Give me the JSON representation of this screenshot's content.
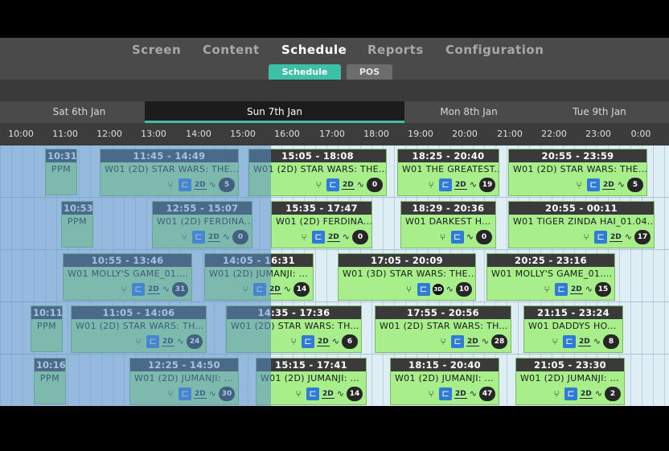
{
  "nav": {
    "items": [
      "Screen",
      "Content",
      "Schedule",
      "Reports",
      "Configuration"
    ],
    "active": "Schedule"
  },
  "subtabs": [
    "Schedule",
    "POS"
  ],
  "days": [
    "Sat 6th Jan",
    "Sun 7th Jan",
    "Mon 8th Jan",
    "Tue 9th Jan"
  ],
  "active_day": "Sun 7th Jan",
  "hours": [
    "10:00",
    "11:00",
    "12:00",
    "13:00",
    "14:00",
    "15:00",
    "16:00",
    "17:00",
    "18:00",
    "19:00",
    "20:00",
    "21:00",
    "22:00",
    "23:00",
    "0:00"
  ],
  "colors": {
    "accent": "#3dbfa8",
    "session_bg": "#a8ee8a",
    "header_bg": "#3a3a3a",
    "past_overlay": "#5a8fca",
    "icon_blue": "#2f7bd6"
  },
  "rows": [
    {
      "ppm": {
        "time": "10:31 -",
        "title": "PPM"
      },
      "sessions": [
        {
          "time": "11:45 - 14:49",
          "title": "W01 (2D) STAR WARS: THE...",
          "format": "2D",
          "count": "5"
        },
        {
          "time": "15:05 - 18:08",
          "title": "W01 (2D) STAR WARS: THE...",
          "format": "2D",
          "count": "0"
        },
        {
          "time": "18:25 - 20:40",
          "title": "W01 THE GREATEST...",
          "format": "2D",
          "count": "19"
        },
        {
          "time": "20:55 - 23:59",
          "title": "W01 (2D) STAR WARS: THE...",
          "format": "2D",
          "count": "5"
        }
      ]
    },
    {
      "ppm": {
        "time": "10:53 -",
        "title": "PPM"
      },
      "sessions": [
        {
          "time": "12:55 - 15:07",
          "title": "W01 (2D) FERDINA...",
          "format": "2D",
          "count": "0"
        },
        {
          "time": "15:35 - 17:47",
          "title": "W01 (2D) FERDINA...",
          "format": "2D",
          "count": "0"
        },
        {
          "time": "18:29 - 20:36",
          "title": "W01 DARKEST H...",
          "format": "",
          "count": "0"
        },
        {
          "time": "20:55 - 00:11",
          "title": "W01 TIGER ZINDA HAI_01.04...",
          "format": "2D",
          "count": "17"
        }
      ]
    },
    {
      "ppm": null,
      "sessions": [
        {
          "time": "10:55 - 13:46",
          "title": "W01 MOLLY'S GAME_01....",
          "format": "2D",
          "count": "31"
        },
        {
          "time": "14:05 - 16:31",
          "title": "W01 (2D) JUMANJI: ...",
          "format": "2D",
          "count": "14"
        },
        {
          "time": "17:05 - 20:09",
          "title": "W01 (3D) STAR WARS: THE...",
          "format": "3D",
          "count": "10"
        },
        {
          "time": "20:25 - 23:16",
          "title": "W01 MOLLY'S GAME_01....",
          "format": "2D",
          "count": "15"
        }
      ]
    },
    {
      "ppm": {
        "time": "10:11 -",
        "title": "PPM"
      },
      "sessions": [
        {
          "time": "11:05 - 14:06",
          "title": "W01 (2D) STAR WARS: TH...",
          "format": "2D",
          "count": "24"
        },
        {
          "time": "14:35 - 17:36",
          "title": "W01 (2D) STAR WARS: TH...",
          "format": "2D",
          "count": "6"
        },
        {
          "time": "17:55 - 20:56",
          "title": "W01 (2D) STAR WARS: TH...",
          "format": "2D",
          "count": "28"
        },
        {
          "time": "21:15 - 23:24",
          "title": "W01 DADDYS HO...",
          "format": "2D",
          "count": "8"
        }
      ]
    },
    {
      "ppm": {
        "time": "10:16 -",
        "title": "PPM"
      },
      "sessions": [
        {
          "time": "12:25 - 14:50",
          "title": "W01 (2D) JUMANJI: ...",
          "format": "2D",
          "count": "30"
        },
        {
          "time": "15:15 - 17:41",
          "title": "W01 (2D) JUMANJI: ...",
          "format": "2D",
          "count": "14"
        },
        {
          "time": "18:15 - 20:40",
          "title": "W01 (2D) JUMANJI: ...",
          "format": "2D",
          "count": "47"
        },
        {
          "time": "21:05 - 23:30",
          "title": "W01 (2D) JUMANJI: ...",
          "format": "2D",
          "count": "2"
        }
      ]
    }
  ]
}
